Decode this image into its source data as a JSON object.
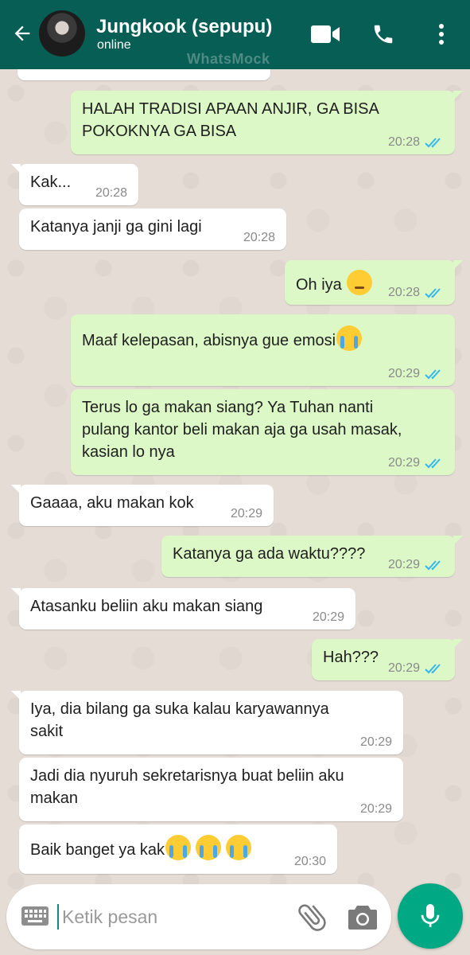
{
  "header": {
    "contact_name": "Jungkook (sepupu)",
    "status": "online",
    "watermark": "WhatsMock"
  },
  "colors": {
    "header": "#075e54",
    "outgoing": "#dcf8c6",
    "incoming": "#ffffff",
    "accent": "#00a884",
    "tick_read": "#34b7f1"
  },
  "messages": [
    {
      "dir": "out",
      "lines": [
        "HALAH TRADISI APAAN ANJIR, GA BISA",
        "POKOKNYA GA BISA"
      ],
      "time": "20:28",
      "read": true
    },
    {
      "dir": "in",
      "lines": [
        "Kak..."
      ],
      "time": "20:28"
    },
    {
      "dir": "in",
      "lines": [
        "Katanya janji ga gini lagi"
      ],
      "time": "20:28"
    },
    {
      "dir": "out",
      "lines": [
        "Oh iya"
      ],
      "emoji": [
        "pensive-face"
      ],
      "time": "20:28",
      "read": true
    },
    {
      "dir": "out",
      "lines": [
        "Maaf kelepasan, abisnya gue emosi"
      ],
      "emoji": [
        "loudly-crying-face"
      ],
      "time": "20:29",
      "read": true
    },
    {
      "dir": "out",
      "lines": [
        "Terus lo ga makan siang? Ya Tuhan nanti",
        "pulang kantor beli makan aja ga usah masak,",
        "kasian lo nya"
      ],
      "time": "20:29",
      "read": true
    },
    {
      "dir": "in",
      "lines": [
        "Gaaaa, aku makan kok"
      ],
      "time": "20:29"
    },
    {
      "dir": "out",
      "lines": [
        "Katanya ga ada waktu????"
      ],
      "time": "20:29",
      "read": true
    },
    {
      "dir": "in",
      "lines": [
        "Atasanku beliin aku makan siang"
      ],
      "time": "20:29"
    },
    {
      "dir": "out",
      "lines": [
        "Hah???"
      ],
      "time": "20:29",
      "read": true
    },
    {
      "dir": "in",
      "lines": [
        "Iya, dia bilang ga suka kalau karyawannya",
        "sakit"
      ],
      "time": "20:29"
    },
    {
      "dir": "in",
      "lines": [
        "Jadi dia nyuruh sekretarisnya buat beliin aku",
        "makan"
      ],
      "time": "20:29"
    },
    {
      "dir": "in",
      "lines": [
        "Baik banget ya kak"
      ],
      "emoji": [
        "loudly-crying-face",
        "loudly-crying-face",
        "loudly-crying-face"
      ],
      "time": "20:30"
    }
  ],
  "composer": {
    "placeholder": "Ketik pesan",
    "keyboard_icon": "keyboard-icon",
    "attach_icon": "paperclip-icon",
    "camera_icon": "camera-icon",
    "mic_icon": "microphone-icon"
  }
}
